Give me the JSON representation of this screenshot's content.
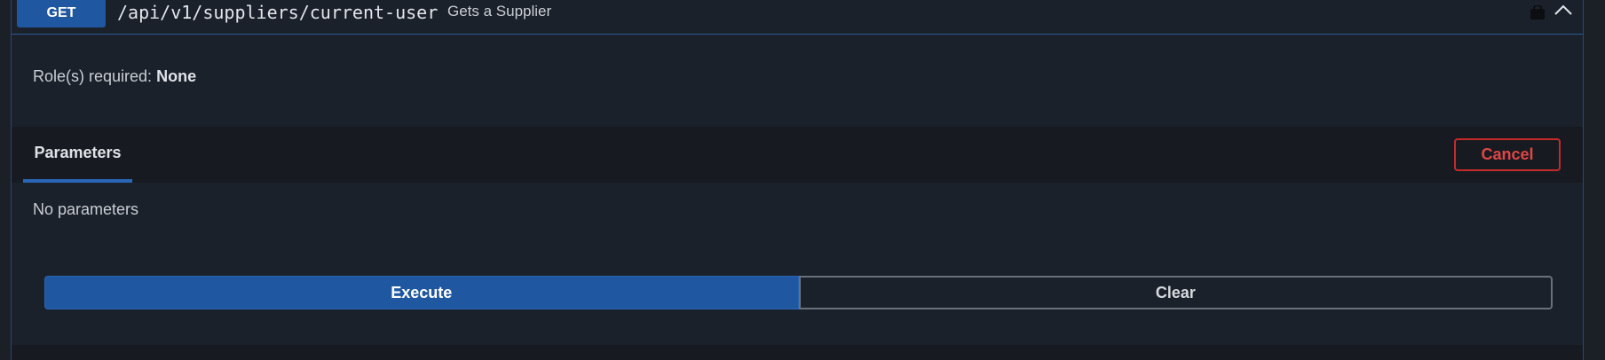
{
  "endpoint": {
    "method": "GET",
    "path": "/api/v1/suppliers/current-user",
    "description": "Gets a Supplier"
  },
  "roles": {
    "label": "Role(s) required:",
    "value": "None"
  },
  "parameters": {
    "tab_label": "Parameters",
    "cancel_label": "Cancel",
    "empty_text": "No parameters"
  },
  "actions": {
    "execute_label": "Execute",
    "clear_label": "Clear"
  },
  "colors": {
    "accent": "#1f57a0",
    "danger": "#c42a2a",
    "background": "#1b212a"
  },
  "icons": {
    "lock": "lock-icon",
    "collapse": "chevron-up-icon"
  }
}
